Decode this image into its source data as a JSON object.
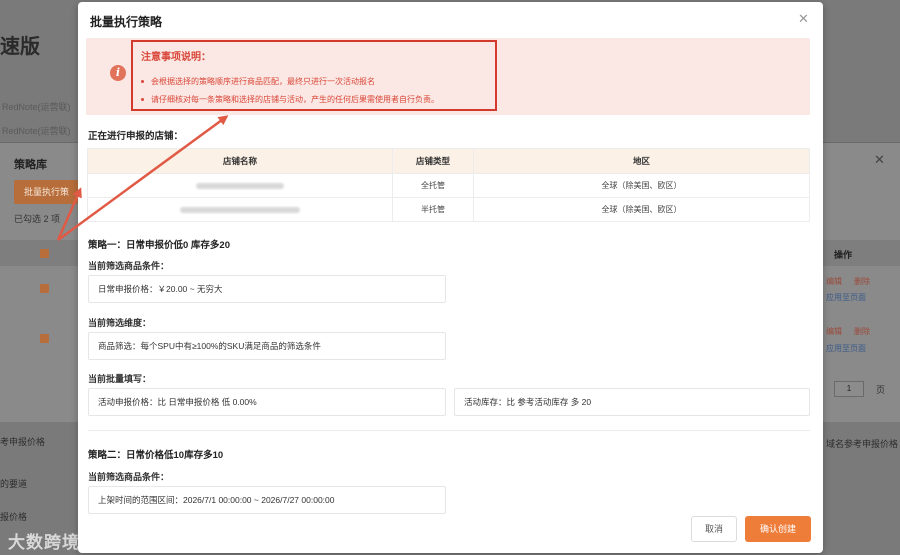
{
  "background": {
    "title": "速版",
    "muted_line_1": "RedNote(运营联)",
    "muted_line_2": "RedNote(运营联)",
    "panel_title": "策略库",
    "batch_button": "批量执行策",
    "selected_count": "已勾选 2 项",
    "ops_header": "操作",
    "row_links": [
      {
        "edit": "编辑",
        "delete": "删除",
        "apply": "应用至页面"
      },
      {
        "edit": "编辑",
        "delete": "删除",
        "apply": "应用至页面"
      }
    ],
    "page_number": "1",
    "page_label": "页",
    "bottom_left_1": "考申报价格",
    "bottom_left_2": "的要道",
    "bottom_left_3": "报价格",
    "bottom_right_1": "域名参考申报价格",
    "watermark": "大数跨境"
  },
  "modal": {
    "title": "批量执行策略",
    "notice": {
      "title": "注意事项说明：",
      "items": [
        "会根据选择的策略顺序进行商品匹配，最终只进行一次活动报名",
        "请仔细核对每一条策略和选择的店铺与活动，产生的任何后果需使用者自行负责。"
      ]
    },
    "stores_title": "正在进行申报的店铺：",
    "table": {
      "headers": [
        "店铺名称",
        "店铺类型",
        "地区"
      ],
      "rows": [
        {
          "name": "",
          "type": "全托管",
          "region": "全球（除美国、欧区）"
        },
        {
          "name": "",
          "type": "半托管",
          "region": "全球（除美国、欧区）"
        }
      ]
    },
    "strategy1": {
      "title": "策略一：日常申报价低0 库存多20",
      "cond_label": "当前筛选商品条件：",
      "cond_value": "日常申报价格：￥20.00 ~ 无穷大",
      "dim_label": "当前筛选维度：",
      "dim_value": "商品筛选：每个SPU中有≥100%的SKU满足商品的筛选条件",
      "fill_label": "当前批量填写：",
      "fill_price": "活动申报价格：比 日常申报价格 低 0.00%",
      "fill_stock": "活动库存：比 参考活动库存 多 20"
    },
    "strategy2": {
      "title": "策略二：日常价格低10库存多10",
      "cond_label": "当前筛选商品条件：",
      "cond_value": "上架时间的范围区间：2026/7/1 00:00:00 ~ 2026/7/27 00:00:00"
    },
    "buttons": {
      "cancel": "取消",
      "confirm": "确认创建"
    }
  },
  "colors": {
    "accent": "#ef7d3a",
    "notice_bg": "#fbe7e3",
    "notice_text": "#d9473a",
    "highlight_border": "#d33a2e"
  }
}
